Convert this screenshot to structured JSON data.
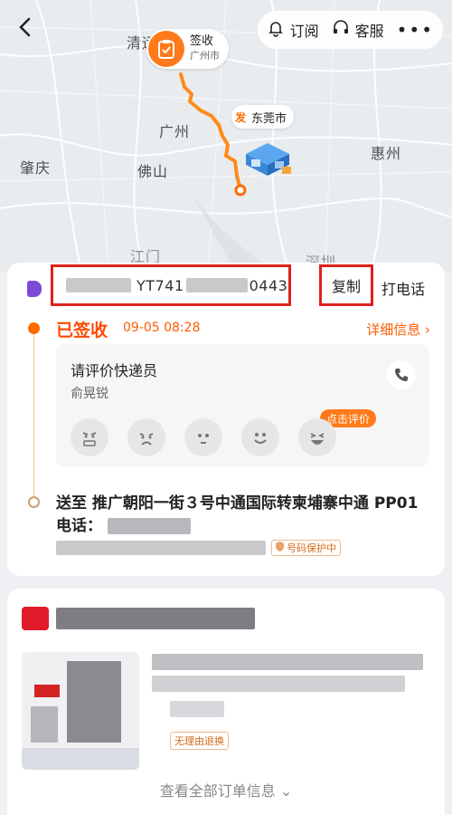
{
  "map": {
    "cities": {
      "qingyuan": "清远",
      "guangzhou": "广州",
      "zhaoqing": "肇庆",
      "foshan": "佛山",
      "huizhou": "惠州",
      "jiangmen": "江门",
      "shenzhen": "深圳"
    },
    "sign_marker": {
      "label": "签收",
      "city": "广州市"
    },
    "send_marker": {
      "badge": "发",
      "city": "东莞市"
    }
  },
  "topbar": {
    "subscribe_label": "订阅",
    "service_label": "客服",
    "more_label": "•••"
  },
  "tracking": {
    "number_visible": "YT741",
    "number_tail": "0443",
    "copy_label": "复制",
    "call_label": "打电话"
  },
  "status": {
    "label": "已签收",
    "time": "09-05 08:28",
    "detail_link": "详细信息 ›"
  },
  "rating": {
    "title": "请评价快递员",
    "courier_name": "俞晃锐",
    "tag": "点击评价"
  },
  "delivery": {
    "address": "送至 推广朝阳一街３号中通国际转柬埔寨中通 PP01 电话：",
    "privacy_tag": "号码保护中"
  },
  "order": {
    "refund_tag": "无理由退换",
    "view_all": "查看全部订单信息 ⌄"
  },
  "colors": {
    "accent": "#ff6a00",
    "highlight_box": "#e0201b",
    "route": "#ff8a1a"
  }
}
